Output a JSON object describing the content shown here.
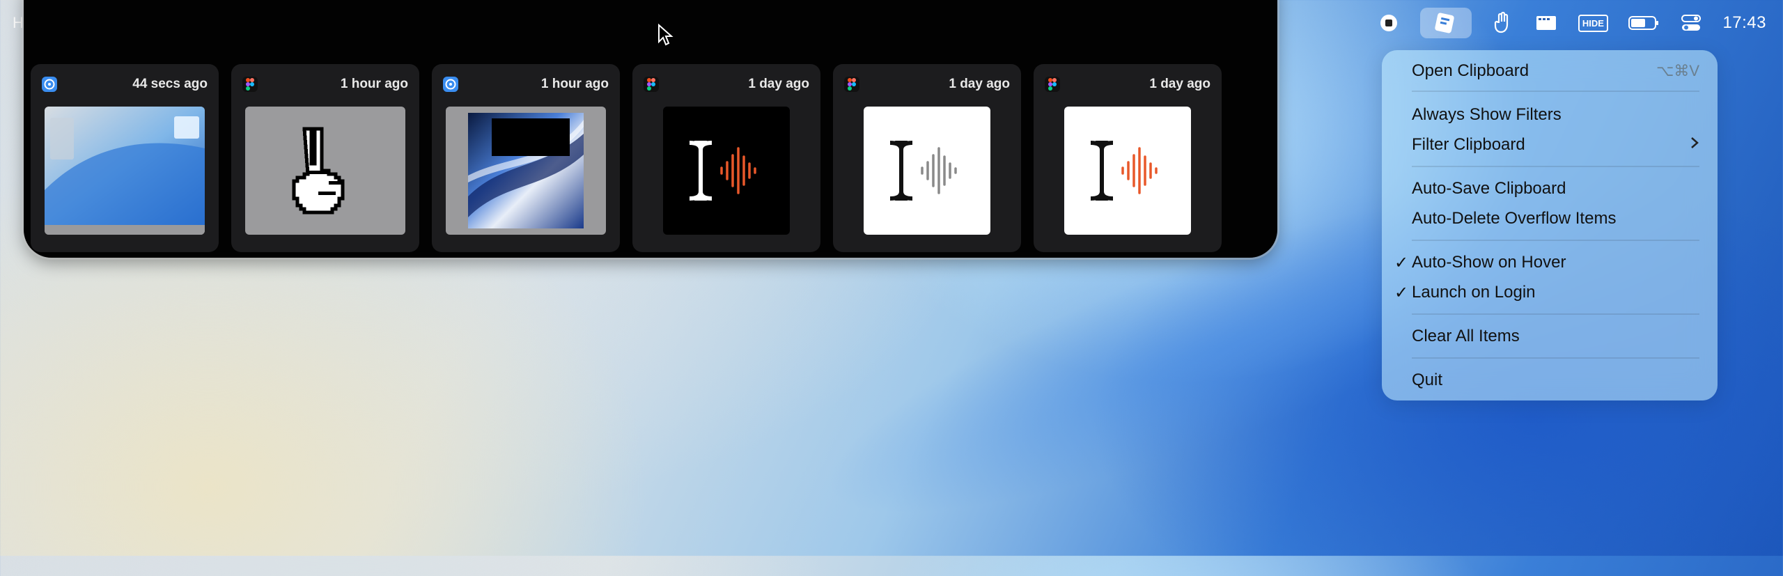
{
  "menubar": {
    "left_text": "H",
    "clock": "17:43",
    "icons": [
      "record-icon",
      "clipboard-app-icon",
      "hand-icon",
      "window-icon",
      "hide-icon",
      "battery-icon",
      "control-center-icon"
    ],
    "hide_label": "HIDE"
  },
  "clipboard": {
    "cards": [
      {
        "app": "finder",
        "time": "44 secs ago",
        "thumb": "desktop-screenshot"
      },
      {
        "app": "figma",
        "time": "1 hour ago",
        "thumb": "peace-hand-pixel"
      },
      {
        "app": "finder",
        "time": "1 hour ago",
        "thumb": "wallpaper-screenshot"
      },
      {
        "app": "figma",
        "time": "1 day ago",
        "thumb": "logo-dark"
      },
      {
        "app": "figma",
        "time": "1 day ago",
        "thumb": "logo-light-gray"
      },
      {
        "app": "figma",
        "time": "1 day ago",
        "thumb": "logo-light-orange"
      }
    ]
  },
  "menu": {
    "open": {
      "label": "Open Clipboard",
      "shortcut": "⌥⌘V"
    },
    "always_show_filters": "Always Show Filters",
    "filter_clipboard": "Filter Clipboard",
    "auto_save": "Auto-Save Clipboard",
    "auto_delete": "Auto-Delete Overflow Items",
    "auto_show": "Auto-Show on Hover",
    "launch_login": "Launch on Login",
    "check": "✓",
    "clear_all": "Clear All Items",
    "quit": "Quit"
  },
  "colors": {
    "accent_orange": "#e8582a",
    "panel_bg": "#020202",
    "card_bg": "#1c1c1e"
  }
}
